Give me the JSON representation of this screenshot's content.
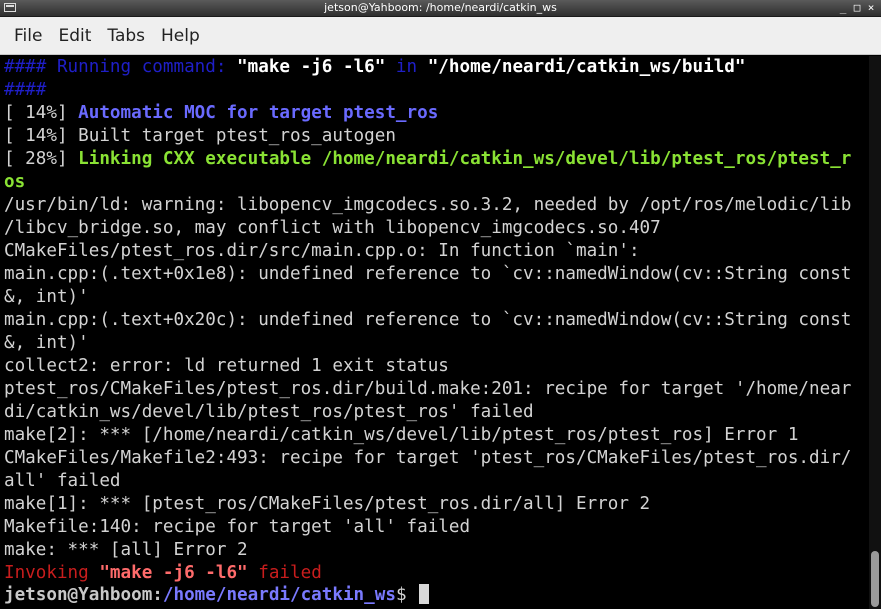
{
  "window": {
    "title": "jetson@Yahboom: /home/neardi/catkin_ws",
    "controls": [
      "_",
      "□",
      "×"
    ]
  },
  "menu": [
    "File",
    "Edit",
    "Tabs",
    "Help"
  ],
  "terminal": {
    "cmd": {
      "prefix": "#### Running command: ",
      "command": "\"make -j6 -l6\"",
      "in_word": " in ",
      "dir": "\"/home/neardi/catkin_ws/build\"",
      "wrap": "####"
    },
    "moc": {
      "pct": "[ 14%] ",
      "text": "Automatic MOC for target ptest_ros"
    },
    "built": "[ 14%] Built target ptest_ros_autogen",
    "linking": {
      "pct": "[ 28%] ",
      "text": "Linking CXX executable /home/neardi/catkin_ws/devel/lib/ptest_ros/ptest_r",
      "wrap": "os"
    },
    "output": [
      "/usr/bin/ld: warning: libopencv_imgcodecs.so.3.2, needed by /opt/ros/melodic/lib",
      "/libcv_bridge.so, may conflict with libopencv_imgcodecs.so.407",
      "CMakeFiles/ptest_ros.dir/src/main.cpp.o: In function `main':",
      "main.cpp:(.text+0x1e8): undefined reference to `cv::namedWindow(cv::String const",
      "&, int)'",
      "main.cpp:(.text+0x20c): undefined reference to `cv::namedWindow(cv::String const",
      "&, int)'",
      "collect2: error: ld returned 1 exit status",
      "ptest_ros/CMakeFiles/ptest_ros.dir/build.make:201: recipe for target '/home/near",
      "di/catkin_ws/devel/lib/ptest_ros/ptest_ros' failed",
      "make[2]: *** [/home/neardi/catkin_ws/devel/lib/ptest_ros/ptest_ros] Error 1",
      "CMakeFiles/Makefile2:493: recipe for target 'ptest_ros/CMakeFiles/ptest_ros.dir/",
      "all' failed",
      "make[1]: *** [ptest_ros/CMakeFiles/ptest_ros.dir/all] Error 2",
      "Makefile:140: recipe for target 'all' failed",
      "make: *** [all] Error 2"
    ],
    "failed": {
      "prefix": "Invoking ",
      "command": "\"make -j6 -l6\"",
      "suffix": " failed"
    },
    "prompt": {
      "user": "jetson@Yahboom",
      "colon": ":",
      "path": "/home/neardi/catkin_ws",
      "symbol": "$ "
    }
  },
  "colors": {
    "background": "#000000",
    "text": "#d3d3d3",
    "running_blue": "#1f1fc8",
    "moc_blue": "#6a6aff",
    "linking_green": "#8ae234",
    "error_red": "#c81d1d",
    "menu_bg": "#efefef",
    "titlebar": "#3a3a3a"
  }
}
